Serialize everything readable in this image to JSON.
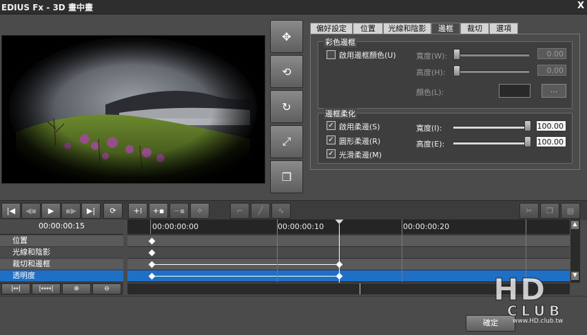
{
  "window": {
    "title": "EDIUS Fx - 3D 畫中畫",
    "close_glyph": "X"
  },
  "tool_buttons": [
    {
      "name": "move-tool-button",
      "glyph": "✥"
    },
    {
      "name": "rotate-3d-tool-button",
      "glyph": "⟲"
    },
    {
      "name": "rotate-tool-button",
      "glyph": "↻"
    },
    {
      "name": "scale-tool-button",
      "glyph": "⤢"
    },
    {
      "name": "shadow-tool-button",
      "glyph": "❐"
    }
  ],
  "tabs": [
    "偏好設定",
    "位置",
    "光線和陰影",
    "邊框",
    "裁切",
    "選項"
  ],
  "active_tab": "邊框",
  "color_border": {
    "group_title": "彩色邊框",
    "enable_label": "啟用邊框顏色(U)",
    "enabled": false,
    "width_label": "寬度(W):",
    "width_value": "0.00",
    "height_label": "高度(H):",
    "height_value": "0.00",
    "color_label": "顏色(L):",
    "color_value": "#2a2a2a",
    "browse_label": "..."
  },
  "soft_border": {
    "group_title": "邊框柔化",
    "enable_soft_label": "啟用柔邊(S)",
    "enable_soft_checked": true,
    "round_soft_label": "圓形柔邊(R)",
    "round_soft_checked": true,
    "smooth_soft_label": "光滑柔邊(M)",
    "smooth_soft_checked": true,
    "width_label": "寬度(I):",
    "width_value": "100.00",
    "width_level": 1.0,
    "height_label": "高度(E):",
    "height_value": "100.00",
    "height_level": 1.0
  },
  "timeline": {
    "current_time": "00:00:00:15",
    "ruler": [
      "00:00:00:00",
      "00:00:00:10",
      "00:00:00:20"
    ],
    "tracks": [
      "位置",
      "光線和陰影",
      "裁切和邊框",
      "透明度"
    ],
    "selected_track": "透明度"
  },
  "footer": {
    "ok_label": "確定"
  },
  "watermark": {
    "logo": "HD",
    "club": "CLUB",
    "url": "www.HD.club.tw"
  }
}
